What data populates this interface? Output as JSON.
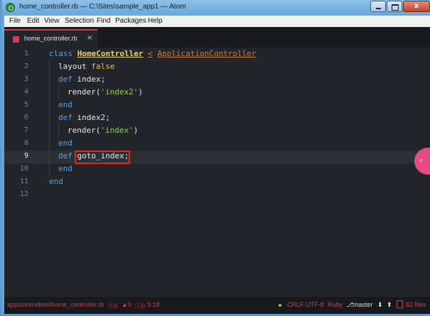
{
  "window": {
    "title": "home_controller.rb — C:\\Sites\\sample_app1 — Atom",
    "close_glyph": "x"
  },
  "menubar": {
    "items": [
      {
        "label": "File"
      },
      {
        "label": "Edit"
      },
      {
        "label": "View"
      },
      {
        "label": "Selection"
      },
      {
        "label": "Find"
      },
      {
        "label": "Packages"
      },
      {
        "label": "Help"
      }
    ]
  },
  "tabs": [
    {
      "label": "home_controller.rb",
      "icon": "ruby-file-icon",
      "close": "×",
      "active": true
    }
  ],
  "editor": {
    "line_numbers": [
      "1",
      "2",
      "3",
      "4",
      "5",
      "6",
      "7",
      "8",
      "9",
      "10",
      "11",
      "12"
    ],
    "active_line": "9",
    "lines": {
      "l1": {
        "kw": "class",
        "cls": "HomeController",
        "lt": "<",
        "sup": "ApplicationController"
      },
      "l2": {
        "ident": "layout",
        "bool": "false"
      },
      "l3": {
        "kw": "def",
        "fn": "index;"
      },
      "l4": {
        "ident": "render(",
        "str": "'index2'",
        "close": ")"
      },
      "l5": {
        "kw": "end"
      },
      "l6": {
        "kw": "def",
        "fn": "index2;"
      },
      "l7": {
        "ident": "render(",
        "str": "'index'",
        "close": ")"
      },
      "l8": {
        "kw": "end"
      },
      "l9": {
        "kw": "def",
        "fn": "goto_index;"
      },
      "l10": {
        "kw": "end"
      },
      "l11": {
        "kw": "end"
      }
    },
    "scroll_handle_glyph": "‹"
  },
  "statusbar": {
    "path": "app\\controllers\\home_controller.rb",
    "errors": "0",
    "warnings": "0",
    "infos": "0",
    "cursor": "9:18",
    "line_ending": "CRLF",
    "encoding": "UTF-8",
    "grammar": "Ruby",
    "branch": "master",
    "files": "82 files",
    "error_glyph": "ⓧ",
    "warning_glyph": "▲",
    "info_glyph": "ⓘ",
    "branch_glyph": "⎇",
    "down_glyph": "⬇",
    "up_glyph": "⬆"
  },
  "colors": {
    "accent": "#d13f54",
    "editor_bg": "#22252a",
    "keyword": "#57a0e6",
    "string": "#8fd23a",
    "class_name": "#f3d161"
  }
}
